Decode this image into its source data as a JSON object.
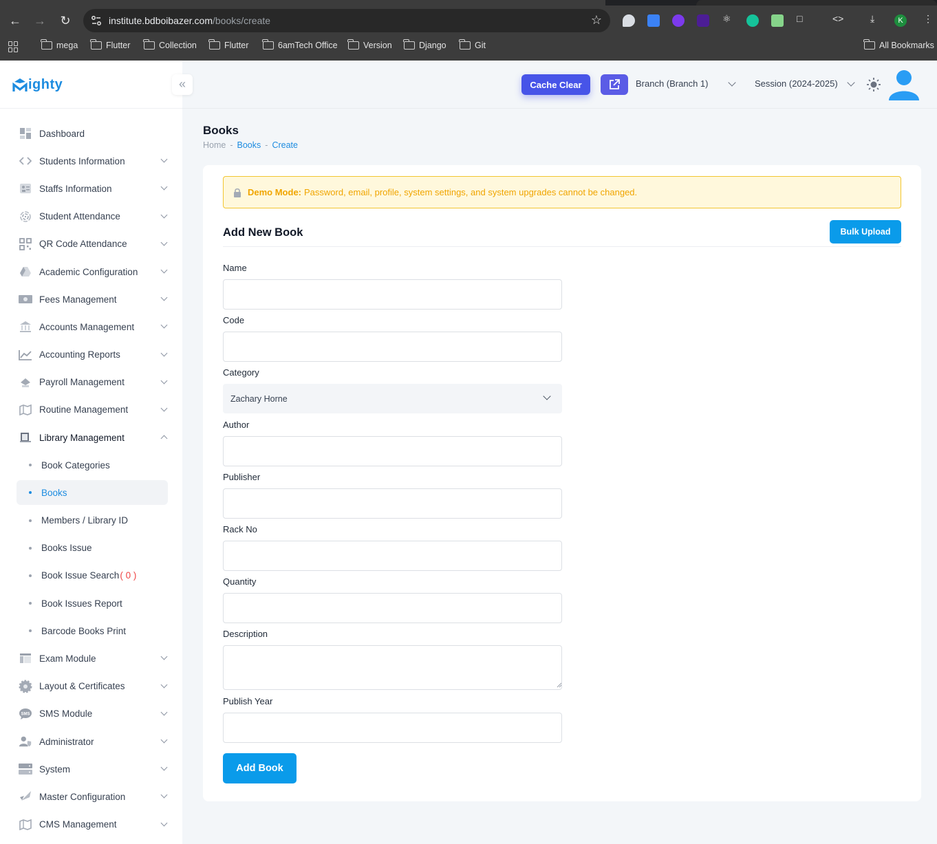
{
  "browser": {
    "url_host": "institute.bdboibazer.com",
    "url_path": "/books/create",
    "bookmarks": [
      "mega",
      "Flutter",
      "Collection",
      "Flutter",
      "6amTech Office",
      "Version",
      "Django",
      "Git"
    ],
    "all_bookmarks": "All Bookmarks",
    "profile_initial": "K"
  },
  "app": {
    "logo_text": "ighty",
    "logo_letter": "M",
    "collapse_icon": "«"
  },
  "header": {
    "cache_clear": "Cache Clear",
    "branch": "Branch (Branch 1)",
    "session": "Session (2024-2025)"
  },
  "sidebar": {
    "items": [
      {
        "label": "Dashboard",
        "icon": "dashboard-icon"
      },
      {
        "label": "Students Information",
        "icon": "code-icon"
      },
      {
        "label": "Staffs Information",
        "icon": "id-card-icon"
      },
      {
        "label": "Student Attendance",
        "icon": "fingerprint-icon"
      },
      {
        "label": "QR Code Attendance",
        "icon": "qr-code-icon"
      },
      {
        "label": "Academic Configuration",
        "icon": "drive-icon"
      },
      {
        "label": "Fees Management",
        "icon": "money-icon"
      },
      {
        "label": "Accounts Management",
        "icon": "bank-icon"
      },
      {
        "label": "Accounting Reports",
        "icon": "chart-line-icon"
      },
      {
        "label": "Payroll Management",
        "icon": "payroll-icon"
      },
      {
        "label": "Routine Management",
        "icon": "map-icon"
      },
      {
        "label": "Library Management",
        "icon": "library-icon"
      }
    ],
    "library_sub": [
      {
        "label": "Book Categories"
      },
      {
        "label": "Books"
      },
      {
        "label": "Members / Library ID"
      },
      {
        "label": "Books Issue"
      },
      {
        "label": "Book Issue Search",
        "count": "( 0 )"
      },
      {
        "label": "Book Issues Report"
      },
      {
        "label": "Barcode Books Print"
      }
    ],
    "items_after": [
      {
        "label": "Exam Module",
        "icon": "layout-icon"
      },
      {
        "label": "Layout & Certificates",
        "icon": "gear-icon"
      },
      {
        "label": "SMS Module",
        "icon": "sms-icon"
      },
      {
        "label": "Administrator",
        "icon": "admin-icon"
      },
      {
        "label": "System",
        "icon": "server-icon"
      },
      {
        "label": "Master Configuration",
        "icon": "rocket-icon"
      },
      {
        "label": "CMS Management",
        "icon": "map-icon"
      }
    ]
  },
  "page": {
    "title": "Books",
    "breadcrumb": [
      "Home",
      "Books",
      "Create"
    ],
    "breadcrumb_sep": "-"
  },
  "form": {
    "demo_bold": "Demo Mode:",
    "demo_text": "Password, email, profile, system settings, and system upgrades cannot be changed.",
    "title": "Add New Book",
    "bulk_upload": "Bulk Upload",
    "labels": {
      "name": "Name",
      "code": "Code",
      "category": "Category",
      "author": "Author",
      "publisher": "Publisher",
      "rack_no": "Rack No",
      "quantity": "Quantity",
      "description": "Description",
      "publish_year": "Publish Year"
    },
    "category_value": "Zachary Horne",
    "submit": "Add Book"
  },
  "colors": {
    "accent": "#0a9bea",
    "cache_btn": "#4754e8",
    "demo_text": "#f0a500"
  }
}
